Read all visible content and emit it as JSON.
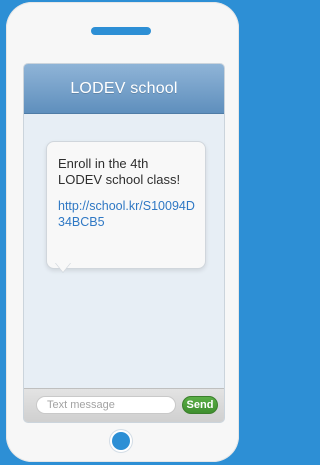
{
  "header": {
    "title": "LODEV school"
  },
  "message": {
    "text": "Enroll in the 4th LODEV school class!",
    "link": "http://school.kr/S10094D34BCB5"
  },
  "composer": {
    "placeholder": "Text message",
    "send_label": "Send"
  },
  "colors": {
    "background": "#2d8fd5",
    "header": "#6f9cca",
    "send": "#4aa13a",
    "link": "#2f78c4"
  },
  "icons": {
    "speaker": "speaker-slot-icon",
    "home": "home-button-icon"
  }
}
